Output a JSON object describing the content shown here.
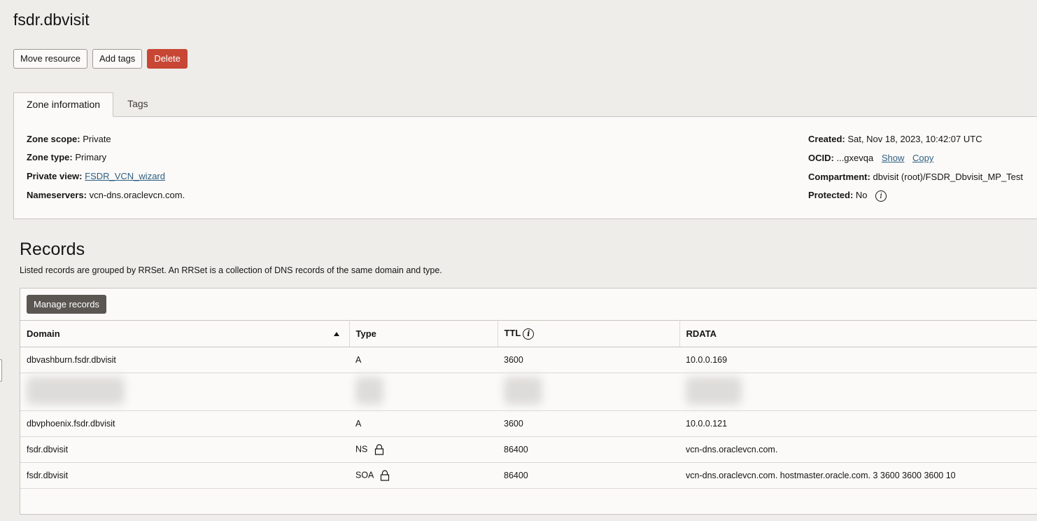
{
  "page": {
    "title": "fsdr.dbvisit"
  },
  "actions": {
    "move": "Move resource",
    "tags": "Add tags",
    "delete": "Delete"
  },
  "tabs": [
    {
      "label": "Zone information"
    },
    {
      "label": "Tags"
    }
  ],
  "zone": {
    "scope_label": "Zone scope:",
    "scope": "Private",
    "type_label": "Zone type:",
    "type": "Primary",
    "view_label": "Private view:",
    "view": "FSDR_VCN_wizard",
    "ns_label": "Nameservers:",
    "ns": "vcn-dns.oraclevcn.com.",
    "created_label": "Created:",
    "created": "Sat, Nov 18, 2023, 10:42:07 UTC",
    "ocid_label": "OCID:",
    "ocid": "...gxevqa",
    "show": "Show",
    "copy": "Copy",
    "compartment_label": "Compartment:",
    "compartment": "dbvisit (root)/FSDR_Dbvisit_MP_Test",
    "protected_label": "Protected:",
    "protected": "No"
  },
  "records": {
    "title": "Records",
    "description": "Listed records are grouped by RRSet. An RRSet is a collection of DNS records of the same domain and type.",
    "manage": "Manage records",
    "columns": {
      "domain": "Domain",
      "type": "Type",
      "ttl": "TTL",
      "rdata": "RDATA"
    },
    "rows": [
      {
        "domain": "dbvashburn.fsdr.dbvisit",
        "type": "A",
        "ttl": "3600",
        "rdata": "10.0.0.169"
      },
      {
        "domain": "dbvphoenix.fsdr.dbvisit",
        "type": "A",
        "ttl": "3600",
        "rdata": "10.0.0.121"
      },
      {
        "domain": "fsdr.dbvisit",
        "type": "NS",
        "ttl": "86400",
        "rdata": "vcn-dns.oraclevcn.com."
      },
      {
        "domain": "fsdr.dbvisit",
        "type": "SOA",
        "ttl": "86400",
        "rdata": "vcn-dns.oraclevcn.com. hostmaster.oracle.com. 3 3600 3600 3600 10"
      }
    ]
  }
}
